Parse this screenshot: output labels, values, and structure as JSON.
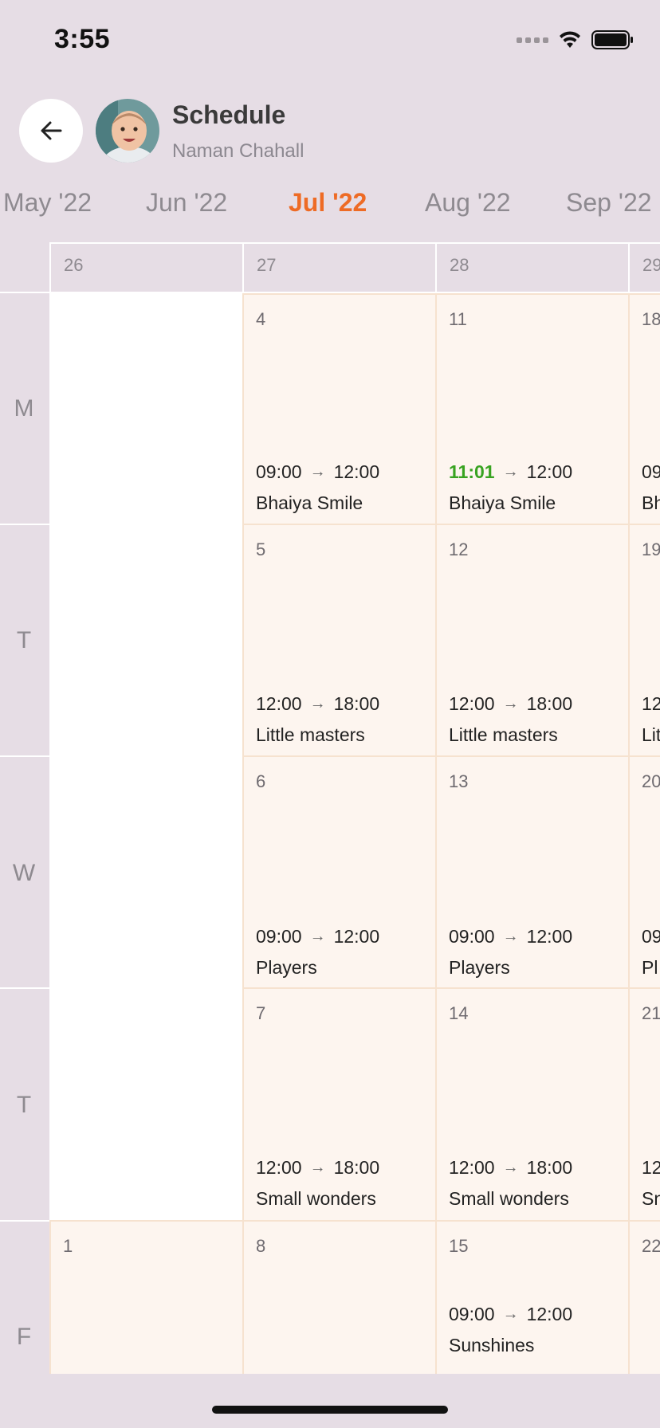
{
  "status": {
    "time": "3:55"
  },
  "header": {
    "title": "Schedule",
    "subtitle": "Naman Chahall",
    "back_icon": "arrow-left-icon"
  },
  "months": [
    {
      "label": "May '22",
      "active": false
    },
    {
      "label": "Jun '22",
      "active": false
    },
    {
      "label": "Jul '22",
      "active": true
    },
    {
      "label": "Aug '22",
      "active": false
    },
    {
      "label": "Sep '22",
      "active": false
    }
  ],
  "calendar": {
    "weeks": [
      "26",
      "27",
      "28",
      "29"
    ],
    "days": [
      "M",
      "T",
      "W",
      "T",
      "F"
    ],
    "cells": {
      "w27": {
        "mon": {
          "date": "4",
          "start": "09:00",
          "end": "12:00",
          "name": "Bhaiya Smile"
        },
        "tue": {
          "date": "5",
          "start": "12:00",
          "end": "18:00",
          "name": "Little masters"
        },
        "wed": {
          "date": "6",
          "start": "09:00",
          "end": "12:00",
          "name": "Players"
        },
        "thu": {
          "date": "7",
          "start": "12:00",
          "end": "18:00",
          "name": "Small wonders"
        },
        "fri": {
          "date": "8"
        }
      },
      "w28": {
        "mon": {
          "date": "11",
          "start": "11:01",
          "end": "12:00",
          "name": "Bhaiya Smile"
        },
        "tue": {
          "date": "12",
          "start": "12:00",
          "end": "18:00",
          "name": "Little masters"
        },
        "wed": {
          "date": "13",
          "start": "09:00",
          "end": "12:00",
          "name": "Players"
        },
        "thu": {
          "date": "14",
          "start": "12:00",
          "end": "18:00",
          "name": "Small wonders"
        },
        "fri": {
          "date": "15",
          "start": "09:00",
          "end": "12:00",
          "name": "Sunshines"
        }
      },
      "w26": {
        "fri": {
          "date": "1"
        }
      },
      "w29": {
        "mon": {
          "date": "18",
          "start": "09",
          "name": "Bh"
        },
        "tue": {
          "date": "19",
          "start": "12",
          "name": "Lit"
        },
        "wed": {
          "date": "20",
          "start": "09",
          "name": "Pl"
        },
        "thu": {
          "date": "21",
          "start": "12",
          "name": "Sn"
        },
        "fri": {
          "date": "22"
        }
      }
    }
  },
  "arrow_glyph": "→",
  "colors": {
    "accent": "#ee6b25",
    "current_time": "#38a321",
    "cell_bg": "#fdf5ef",
    "background": "#e6dde5"
  }
}
